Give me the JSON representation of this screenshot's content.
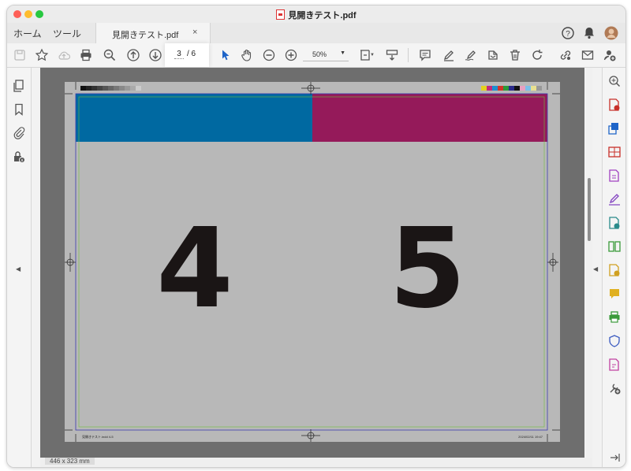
{
  "window": {
    "title": "見開きテスト.pdf"
  },
  "tabs": {
    "home": "ホーム",
    "tools": "ツール",
    "document": "見開きテスト.pdf",
    "close": "×"
  },
  "toolbar": {
    "page_current": "3",
    "page_total": "/ 6",
    "zoom": "50%",
    "icons": [
      "save-icon",
      "star-icon",
      "cloud-upload-icon",
      "print-icon",
      "search-zoom-icon",
      "page-up-icon",
      "page-down-icon",
      "select-arrow-icon",
      "hand-icon",
      "zoom-out-icon",
      "zoom-in-icon",
      "fit-page-icon",
      "scroll-mode-icon",
      "comment-icon",
      "highlight-icon",
      "sign-icon",
      "stamp-icon",
      "delete-icon",
      "rotate-icon",
      "link-icon",
      "mail-icon",
      "add-user-icon"
    ]
  },
  "document": {
    "left_page_number": "4",
    "right_page_number": "5",
    "footer_left": "見開きテスト.indd 4-5",
    "footer_right": "2024/02/11 19:47",
    "dimensions": "446 x 323 mm",
    "colors": {
      "cyan_band": "#0069a1",
      "magenta_band": "#951a5a",
      "page_bg": "#b8b8b8",
      "number": "#1a1515"
    }
  },
  "accent": "#1e64c8"
}
